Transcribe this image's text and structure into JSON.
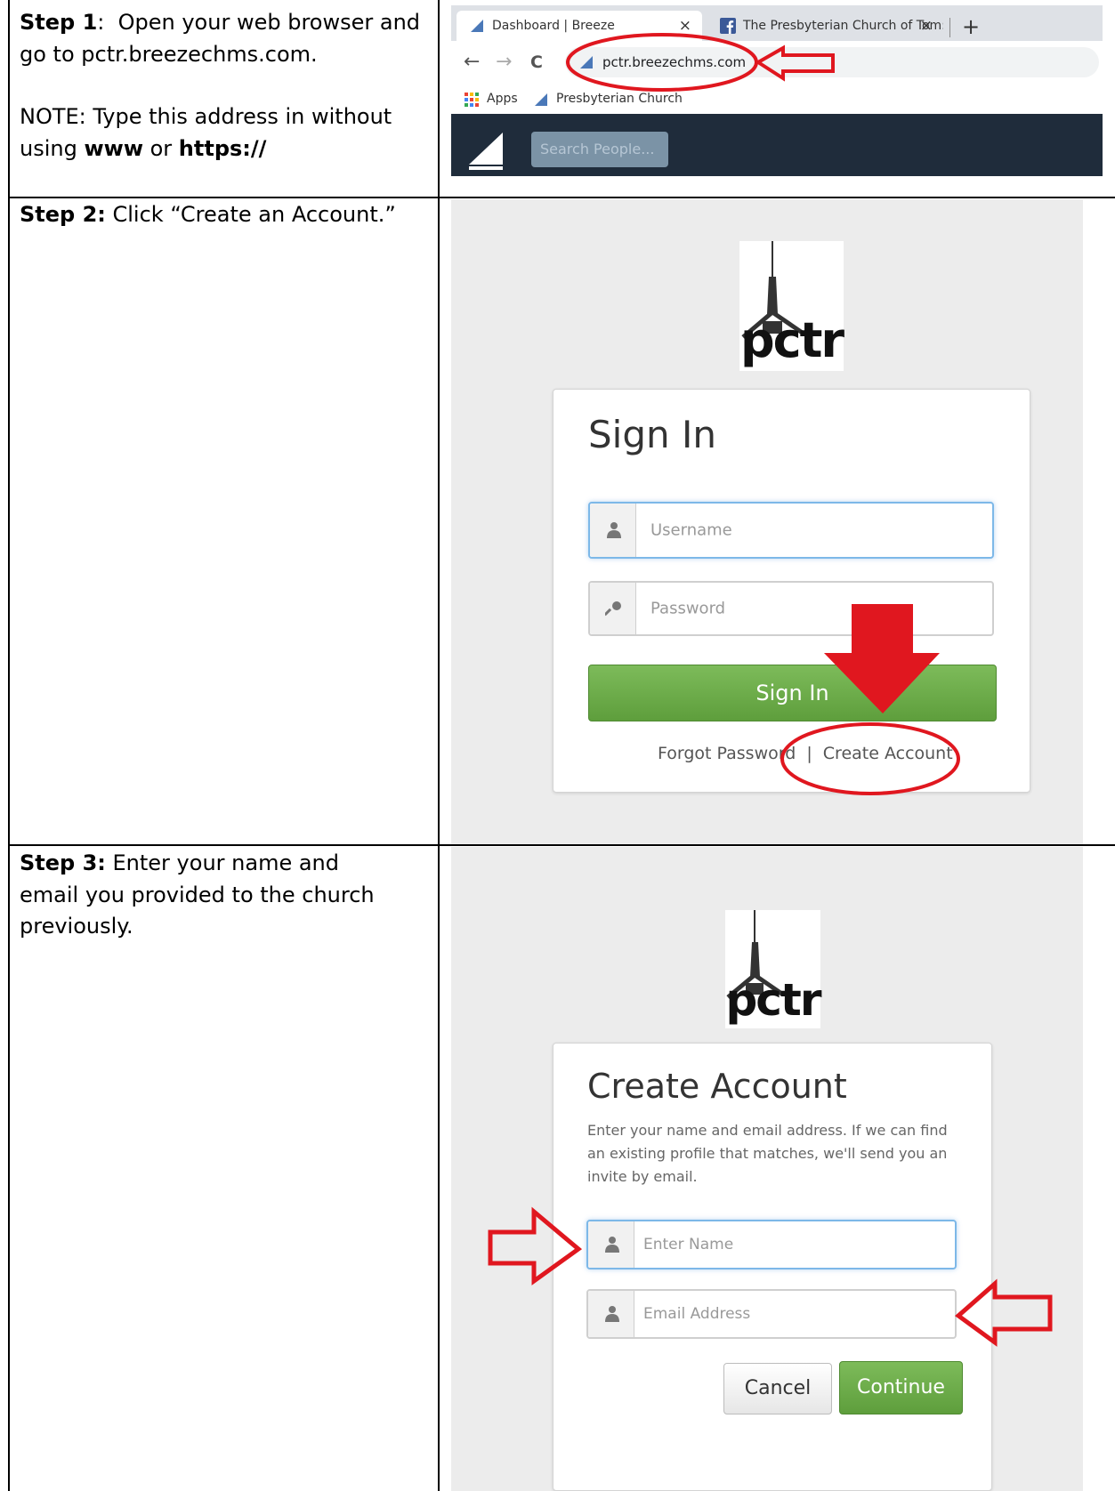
{
  "steps": [
    {
      "label": "Step 1",
      "sep": ":  ",
      "line1": "Open your web browser and go to pctr.breezechms.com.",
      "note_prefix": "NOTE: Type this address in without using ",
      "note_bold1": "www",
      "note_mid": " or ",
      "note_bold2": "https://"
    },
    {
      "label": "Step 2:",
      "text": " Click “Create an Account.”"
    },
    {
      "label": "Step 3:",
      "text": " Enter your name and email you provided to the church previously."
    }
  ],
  "browser": {
    "tab_active": "Dashboard | Breeze",
    "tab_inactive": "The Presbyterian Church of Tom:",
    "tab_close": "×",
    "new_tab": "+",
    "back": "←",
    "forward": "→",
    "reload": "C",
    "url": "pctr.breezechms.com",
    "bookmark_apps": "Apps",
    "bookmark_church": "Presbyterian Church",
    "search_placeholder": "Search People..."
  },
  "signin": {
    "logo_text": "pctr",
    "title": "Sign In",
    "username_placeholder": "Username",
    "password_placeholder": "Password",
    "button": "Sign In",
    "forgot": "Forgot Password",
    "divider": "|",
    "create": "Create Account"
  },
  "create": {
    "logo_text": "pctr",
    "title": "Create Account",
    "description": "Enter your name and email address. If we can find an existing profile that matches, we'll send you an invite by email.",
    "name_placeholder": "Enter Name",
    "email_placeholder": "Email Address",
    "cancel": "Cancel",
    "continue": "Continue"
  },
  "colors": {
    "annotation_red": "#e0171f",
    "button_green": "#6aaa48",
    "app_navbar": "#1f2c3b",
    "panel_bg": "#ececec",
    "focus_blue": "#7db8e8"
  }
}
